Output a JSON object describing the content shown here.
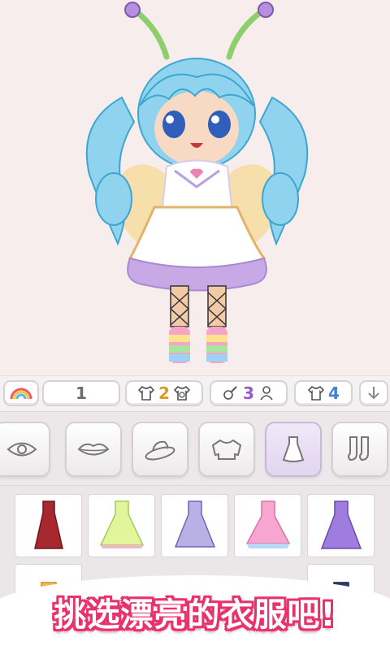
{
  "toolbar": {
    "slot_count": "1",
    "tops_count": "2",
    "accessory_count": "3",
    "dress_count": "4"
  },
  "tabs": [
    "eye-icon",
    "lips-icon",
    "hat-icon",
    "sweater-icon",
    "dress-icon",
    "socks-icon"
  ],
  "selected_tab": "dress",
  "banner": {
    "text": "挑选漂亮的衣服吧!"
  },
  "colors": {
    "accent": "#e9316c",
    "tops_num": "#d99c21",
    "accessory_num": "#9b57c9",
    "dress_num": "#3f7fd8",
    "slot_num": "#6c6c6c"
  },
  "grid_items": [
    "dark-red-gown-icon",
    "lime-rainbow-dress-icon",
    "lavender-lace-dress-icon",
    "pink-rainbow-dress-icon",
    "purple-starry-dress-icon",
    "orange-dress-icon",
    "navy-dress-icon"
  ]
}
